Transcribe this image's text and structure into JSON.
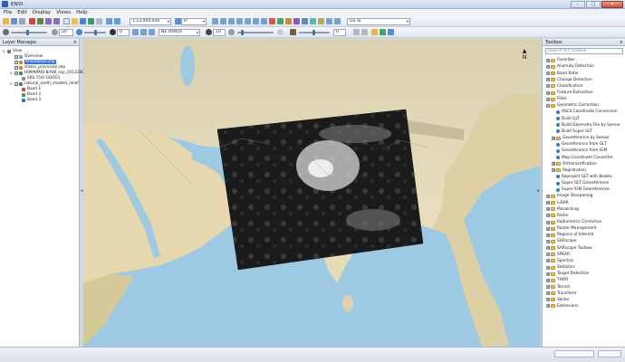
{
  "window": {
    "title": "ENVI",
    "controls": [
      "–",
      "□",
      "✕"
    ]
  },
  "menu": [
    "File",
    "Edit",
    "Display",
    "Views",
    "Help"
  ],
  "toolbar": {
    "scale": "1:13,004,056",
    "rotation": "0°",
    "goto": "Go To",
    "stretch": "No stretch",
    "value_1": "20",
    "value_2": "0",
    "value_3": "10"
  },
  "layer_manager": {
    "title": "Layer Manager",
    "items": [
      {
        "label": "View",
        "indent": 0,
        "expander": "⊟",
        "checked": null,
        "selected": false,
        "icon": "view-icon"
      },
      {
        "label": "Overview",
        "indent": 1,
        "expander": "",
        "checked": true,
        "selected": false,
        "icon": "overview-icon"
      },
      {
        "label": "Annotation.shp",
        "indent": 1,
        "expander": "",
        "checked": true,
        "selected": true,
        "icon": "vector-layer-icon"
      },
      {
        "label": "states_provinces.shp",
        "indent": 1,
        "expander": "",
        "checked": true,
        "selected": false,
        "icon": "vector-layer-icon"
      },
      {
        "label": "HIMAWARI-8/AHI_ssp_20131009",
        "indent": 1,
        "expander": "⊟",
        "checked": true,
        "selected": false,
        "icon": "raster-layer-icon"
      },
      {
        "label": "SRS TOU GOOD1",
        "indent": 2,
        "expander": "",
        "checked": null,
        "selected": false,
        "icon": "crs-icon"
      },
      {
        "label": "natural_earth_shaded_relief",
        "indent": 1,
        "expander": "⊟",
        "checked": true,
        "selected": false,
        "icon": "raster-layer-icon"
      },
      {
        "label": "Band 1",
        "indent": 2,
        "expander": "",
        "checked": null,
        "selected": false,
        "icon": "band-red-icon"
      },
      {
        "label": "Band 2",
        "indent": 2,
        "expander": "",
        "checked": null,
        "selected": false,
        "icon": "band-green-icon"
      },
      {
        "label": "Band 3",
        "indent": 2,
        "expander": "",
        "checked": null,
        "selected": false,
        "icon": "band-blue-icon"
      }
    ]
  },
  "map": {
    "north_label": "N"
  },
  "toolbox": {
    "title": "Toolbox",
    "search_placeholder": "Search the toolbox",
    "items": [
      {
        "label": "Favorites",
        "indent": 0,
        "kind": "folder",
        "expander": "⊞"
      },
      {
        "label": "Anomaly Detection",
        "indent": 0,
        "kind": "folder",
        "expander": "⊞"
      },
      {
        "label": "Band Ratio",
        "indent": 0,
        "kind": "folder",
        "expander": "⊞"
      },
      {
        "label": "Change Detection",
        "indent": 0,
        "kind": "folder",
        "expander": "⊞"
      },
      {
        "label": "Classification",
        "indent": 0,
        "kind": "folder",
        "expander": "⊞"
      },
      {
        "label": "Feature Extraction",
        "indent": 0,
        "kind": "folder",
        "expander": "⊞"
      },
      {
        "label": "Filter",
        "indent": 0,
        "kind": "folder",
        "expander": "⊞"
      },
      {
        "label": "Geometric Correction",
        "indent": 0,
        "kind": "folder",
        "expander": "⊟"
      },
      {
        "label": "ASCII Coordinate Conversion",
        "indent": 1,
        "kind": "tool",
        "expander": ""
      },
      {
        "label": "Build GLT",
        "indent": 1,
        "kind": "tool",
        "expander": ""
      },
      {
        "label": "Build Geometry File by Sensor",
        "indent": 1,
        "kind": "tool",
        "expander": ""
      },
      {
        "label": "Build Super GLT",
        "indent": 1,
        "kind": "tool",
        "expander": ""
      },
      {
        "label": "Georeference by Sensor",
        "indent": 1,
        "kind": "folder",
        "expander": "⊞"
      },
      {
        "label": "Georeference from GLT",
        "indent": 1,
        "kind": "tool",
        "expander": ""
      },
      {
        "label": "Georeference from IGM",
        "indent": 1,
        "kind": "tool",
        "expander": ""
      },
      {
        "label": "Map Coordinate Converter",
        "indent": 1,
        "kind": "tool",
        "expander": ""
      },
      {
        "label": "Orthorectification",
        "indent": 1,
        "kind": "folder",
        "expander": "⊞"
      },
      {
        "label": "Registration",
        "indent": 1,
        "kind": "folder",
        "expander": "⊞"
      },
      {
        "label": "Reproject GLT with Bowtie",
        "indent": 1,
        "kind": "tool",
        "expander": ""
      },
      {
        "label": "Super GLT Georeference",
        "indent": 1,
        "kind": "tool",
        "expander": ""
      },
      {
        "label": "Super IGM Georeference",
        "indent": 1,
        "kind": "tool",
        "expander": ""
      },
      {
        "label": "Image Sharpening",
        "indent": 0,
        "kind": "folder",
        "expander": "⊞"
      },
      {
        "label": "LiDAR",
        "indent": 0,
        "kind": "folder",
        "expander": "⊞"
      },
      {
        "label": "Mosaicking",
        "indent": 0,
        "kind": "folder",
        "expander": "⊞"
      },
      {
        "label": "Radar",
        "indent": 0,
        "kind": "folder",
        "expander": "⊞"
      },
      {
        "label": "Radiometric Correction",
        "indent": 0,
        "kind": "folder",
        "expander": "⊞"
      },
      {
        "label": "Raster Management",
        "indent": 0,
        "kind": "folder",
        "expander": "⊞"
      },
      {
        "label": "Regions of Interest",
        "indent": 0,
        "kind": "folder",
        "expander": "⊞"
      },
      {
        "label": "SARscape",
        "indent": 0,
        "kind": "folder",
        "expander": "⊞"
      },
      {
        "label": "SARscape Toolbox",
        "indent": 0,
        "kind": "folder",
        "expander": "⊞"
      },
      {
        "label": "SPEAR",
        "indent": 0,
        "kind": "folder",
        "expander": "⊞"
      },
      {
        "label": "Spectral",
        "indent": 0,
        "kind": "folder",
        "expander": "⊞"
      },
      {
        "label": "Statistics",
        "indent": 0,
        "kind": "folder",
        "expander": "⊞"
      },
      {
        "label": "Target Detection",
        "indent": 0,
        "kind": "folder",
        "expander": "⊞"
      },
      {
        "label": "THOR",
        "indent": 0,
        "kind": "folder",
        "expander": "⊞"
      },
      {
        "label": "Terrain",
        "indent": 0,
        "kind": "folder",
        "expander": "⊞"
      },
      {
        "label": "Transform",
        "indent": 0,
        "kind": "folder",
        "expander": "⊞"
      },
      {
        "label": "Vector",
        "indent": 0,
        "kind": "folder",
        "expander": "⊞"
      },
      {
        "label": "Extensions",
        "indent": 0,
        "kind": "folder",
        "expander": "⊞"
      }
    ]
  },
  "colors": {
    "ocean": "#9dc9e3",
    "land": "#e8dcb8",
    "selection": "#3875d7",
    "folder": "#e3c15a"
  }
}
